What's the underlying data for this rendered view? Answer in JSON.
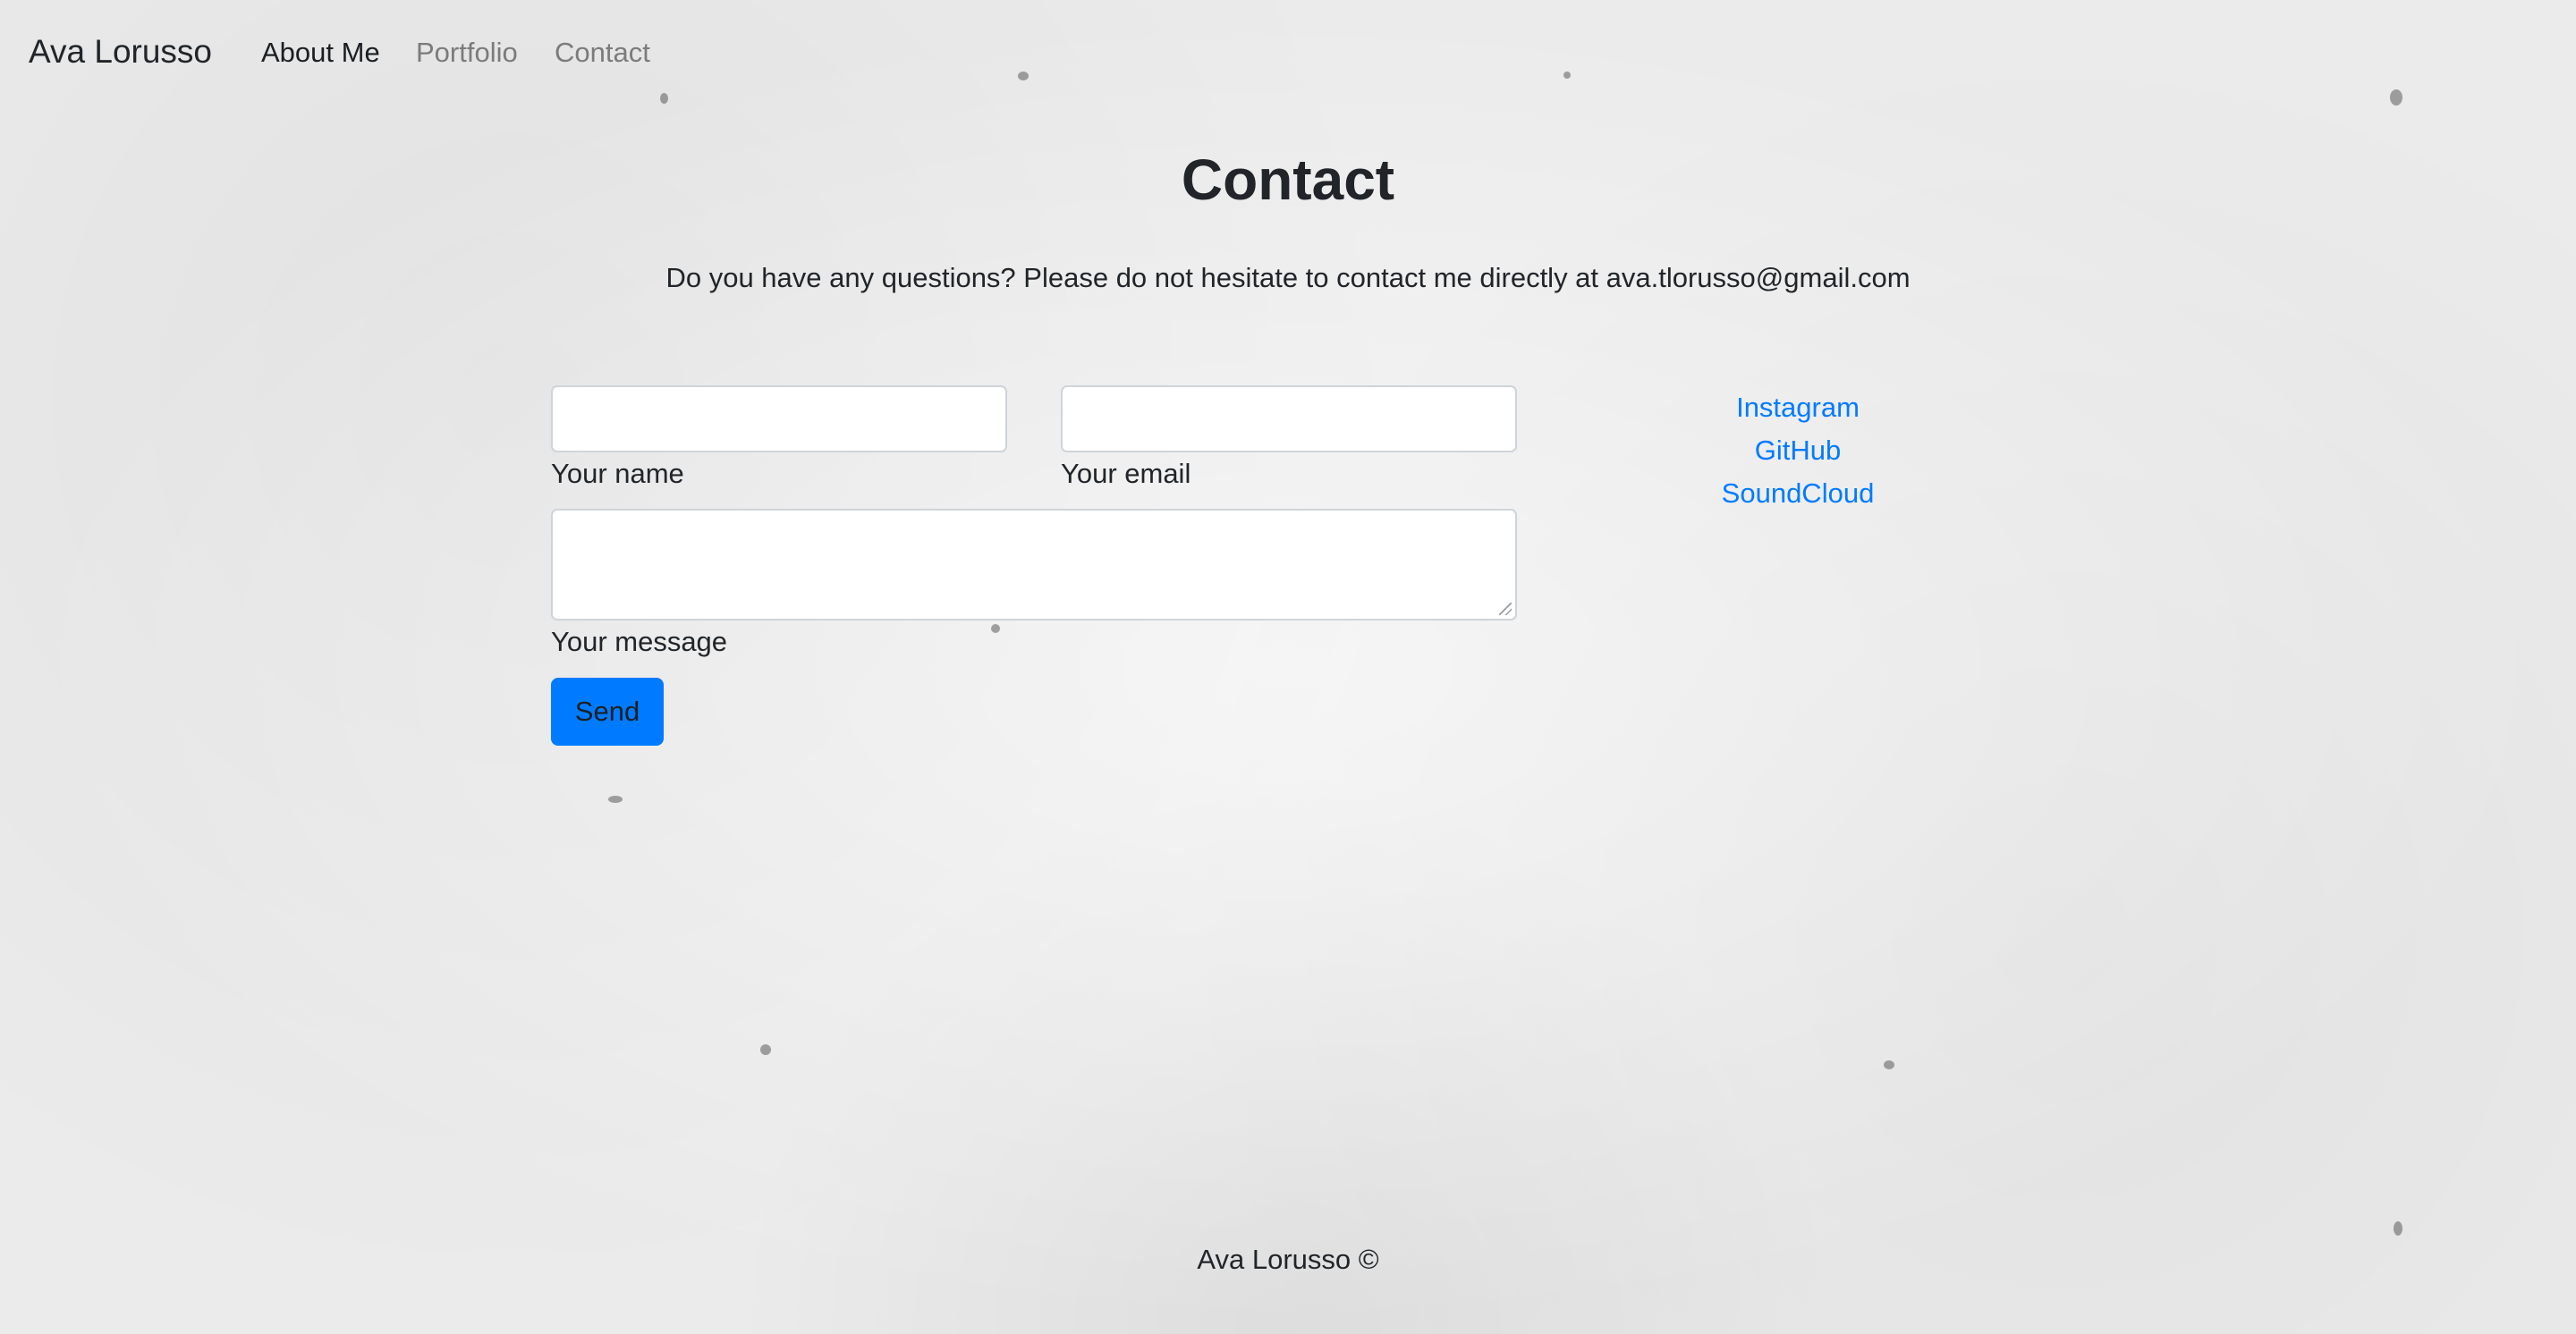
{
  "navbar": {
    "brand": "Ava Lorusso",
    "links": [
      {
        "label": "About Me"
      },
      {
        "label": "Portfolio"
      },
      {
        "label": "Contact"
      }
    ]
  },
  "main": {
    "title": "Contact",
    "intro": "Do you have any questions? Please do not hesitate to contact me directly at ava.tlorusso@gmail.com",
    "form": {
      "name_label": "Your name",
      "name_value": "",
      "email_label": "Your email",
      "email_value": "",
      "message_label": "Your message",
      "message_value": "",
      "send_label": "Send"
    },
    "social_links": [
      {
        "label": "Instagram"
      },
      {
        "label": "GitHub"
      },
      {
        "label": "SoundCloud"
      }
    ]
  },
  "footer": {
    "text": "Ava Lorusso ©"
  },
  "colors": {
    "accent": "#007bff",
    "text": "#212529",
    "muted_nav": "#7b7b7b",
    "background": "#ebebeb"
  }
}
